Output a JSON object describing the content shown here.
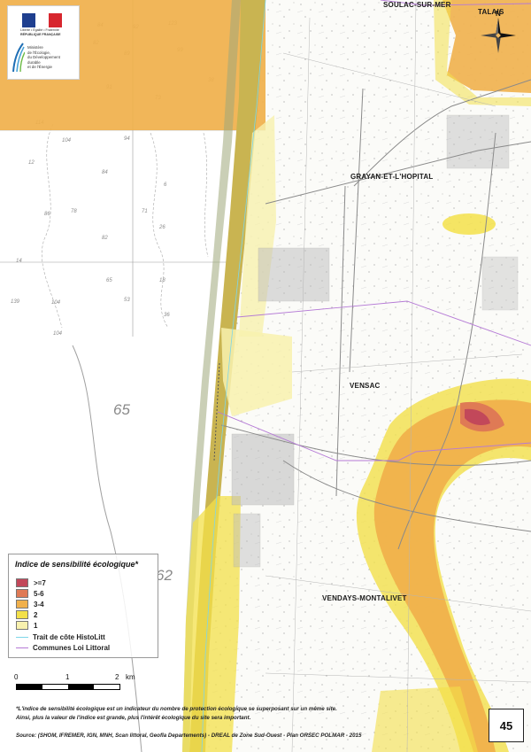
{
  "logo": {
    "flag_colors": [
      "#1f3f8f",
      "#ffffff",
      "#d7262e"
    ],
    "republic_motto": "Liberté • Égalité • Fraternité",
    "republic_name": "RÉPUBLIQUE FRANÇAISE",
    "ministry_line1": "Ministère",
    "ministry_line2": "de l'Écologie,",
    "ministry_line3": "du Développement",
    "ministry_line4": "durable",
    "ministry_line5": "et de l'Énergie"
  },
  "places": {
    "soulac": "SOULAC-SUR-MER",
    "talais": "TALAIS",
    "grayan": "GRAYAN-ET-L'HOPITAL",
    "vensac": "VENSAC",
    "vendays": "VENDAYS-MONTALIVET"
  },
  "compass": {
    "north_label": "N"
  },
  "depth_labels": {
    "d65": "65",
    "d62": "62"
  },
  "legend": {
    "title": "Indice de sensibilité écologique*",
    "classes": [
      {
        "label": ">=7",
        "color": "#c2485a"
      },
      {
        "label": "5-6",
        "color": "#df7a55"
      },
      {
        "label": "3-4",
        "color": "#f0b04b"
      },
      {
        "label": "2",
        "color": "#f3e04a"
      },
      {
        "label": "1",
        "color": "#f8f1ae"
      }
    ],
    "lines": [
      {
        "label": "Trait de côte HistoLitt",
        "color": "#7ed6e8"
      },
      {
        "label": "Communes Loi Littoral",
        "color": "#b57ad6"
      }
    ]
  },
  "scale": {
    "l0": "0",
    "l1": "1",
    "l2": "2",
    "unit": "km"
  },
  "notes": {
    "line1": "*L'indice de sensibilité écologique est un indicateur du nombre de protection écologique se superposant sur un même site.",
    "line2": "Ainsi, plus la valeur de l'indice est grande, plus l'intérêt écologique du site sera important.",
    "source": "Source: (SHOM, IFREMER, IGN, MNH, Scan littoral, Geofla Departements) - DREAL de Zone Sud-Ouest - Plan ORSEC POLMAR - 2015"
  },
  "page_number": "45"
}
